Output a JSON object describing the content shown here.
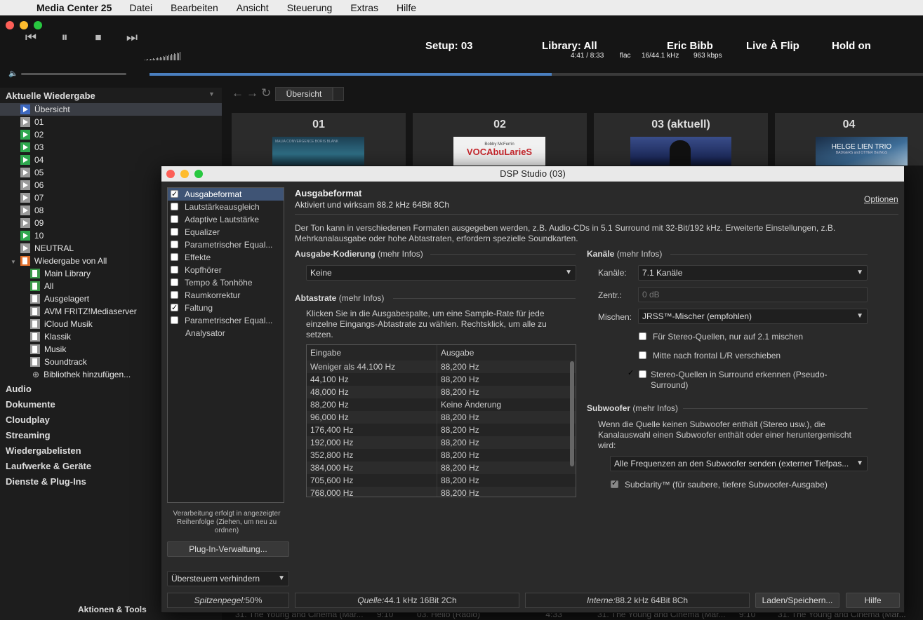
{
  "menubar": {
    "apple": "",
    "app": "Media Center 25",
    "items": [
      "Datei",
      "Bearbeiten",
      "Ansicht",
      "Steuerung",
      "Extras",
      "Hilfe"
    ]
  },
  "transport": {
    "prev": "⏮",
    "pause": "⏸",
    "stop": "⏹",
    "next": "⏭",
    "volume_icon": "🔈"
  },
  "nowplaying": {
    "setup": "Setup: 03",
    "library": "Library: All",
    "time": "4:41 / 8:33",
    "format": "flac",
    "rate": "16/44.1 kHz",
    "bitrate": "963 kbps",
    "artist": "Eric Bibb",
    "album": "Live À Flip",
    "track": "Hold on",
    "progress": 0.52
  },
  "sidebar": {
    "header": "Aktuelle Wiedergabe",
    "items": [
      {
        "label": "Übersicht"
      },
      {
        "label": "01"
      },
      {
        "label": "02"
      },
      {
        "label": "03"
      },
      {
        "label": "04"
      },
      {
        "label": "05"
      },
      {
        "label": "06"
      },
      {
        "label": "07"
      },
      {
        "label": "08"
      },
      {
        "label": "09"
      },
      {
        "label": "10"
      },
      {
        "label": "NEUTRAL"
      },
      {
        "label": "Wiedergabe von All"
      },
      {
        "label": "Main Library"
      },
      {
        "label": "All"
      },
      {
        "label": "Ausgelagert"
      },
      {
        "label": "AVM FRITZ!Mediaserver"
      },
      {
        "label": "iCloud Musik"
      },
      {
        "label": "Klassik"
      },
      {
        "label": "Musik"
      },
      {
        "label": "Soundtrack"
      },
      {
        "label": "Bibliothek hinzufügen..."
      }
    ],
    "sections": [
      "Audio",
      "Dokumente",
      "Cloudplay",
      "Streaming",
      "Wiedergabelisten",
      "Laufwerke & Geräte",
      "Dienste & Plug-Ins"
    ],
    "footer": "Aktionen & Tools"
  },
  "tabs": {
    "overview": "Übersicht"
  },
  "tiles": [
    {
      "title": "01"
    },
    {
      "title": "02"
    },
    {
      "title": "03 (aktuell)"
    },
    {
      "title": "04"
    }
  ],
  "covers": {
    "c1_text": "MALIA   CONVERGENCE   BORIS BLANK",
    "c2_text": "VOCAbuLarieS",
    "c2_sub": "Bobby McFerrin",
    "c4_text": "HELGE LIEN TRIO",
    "c4_sub": "BADGERS and OTHER BEINGS"
  },
  "bgrows": [
    {
      "text": "31. The Young and Cinema (Mar...",
      "dur": "9:10"
    },
    {
      "text": "03. Hello (Radio)",
      "dur": "4:33"
    },
    {
      "text": "31. The Young and Cinema (Mar...",
      "dur": "9:10"
    },
    {
      "text": "31. The Young and Cinema (Mar...",
      "dur": ""
    }
  ],
  "dsp": {
    "title": "DSP Studio (03)",
    "list": [
      {
        "label": "Ausgabeformat",
        "checked": true
      },
      {
        "label": "Lautstärkeausgleich",
        "checked": false
      },
      {
        "label": "Adaptive Lautstärke",
        "checked": false
      },
      {
        "label": "Equalizer",
        "checked": false
      },
      {
        "label": "Parametrischer Equal...",
        "checked": false
      },
      {
        "label": "Effekte",
        "checked": false
      },
      {
        "label": "Kopfhörer",
        "checked": false
      },
      {
        "label": "Tempo & Tonhöhe",
        "checked": false
      },
      {
        "label": "Raumkorrektur",
        "checked": false
      },
      {
        "label": "Faltung",
        "checked": true
      },
      {
        "label": "Parametrischer Equal...",
        "checked": false
      },
      {
        "label": "Analysator",
        "checked": null
      }
    ],
    "order_note": "Verarbeitung erfolgt in angezeigter Reihenfolge (Ziehen, um neu zu ordnen)",
    "plugin_btn": "Plug-In-Verwaltung...",
    "clip_select": "Übersteuern verhindern",
    "heading": "Ausgabeformat",
    "subheading": "Aktiviert und wirksam 88.2 kHz 64Bit 8Ch",
    "options_link": "Optionen",
    "description": "Der Ton kann in verschiedenen Formaten ausgegeben werden, z.B. Audio-CDs in 5.1 Surround mit 32-Bit/192 kHz.  Erweiterte Einstellungen, z.B. Mehrkanalausgabe oder hohe Abtastraten, erfordern spezielle Soundkarten.",
    "encoding_title": "Ausgabe-Kodierung",
    "more": "(mehr Infos)",
    "encoding_value": "Keine",
    "rate_title": "Abtastrate",
    "rate_desc": "Klicken Sie in die Ausgabespalte, um eine Sample-Rate für jede einzelne Eingangs-Abtastrate zu wählen. Rechtsklick, um alle zu setzen.",
    "rate_cols": [
      "Eingabe",
      "Ausgabe"
    ],
    "rates": [
      [
        "Weniger als 44.100 Hz",
        "88,200 Hz"
      ],
      [
        "44,100 Hz",
        "88,200 Hz"
      ],
      [
        "48,000 Hz",
        "88,200 Hz"
      ],
      [
        "88,200 Hz",
        "Keine Änderung"
      ],
      [
        "96,000 Hz",
        "88,200 Hz"
      ],
      [
        "176,400 Hz",
        "88,200 Hz"
      ],
      [
        "192,000 Hz",
        "88,200 Hz"
      ],
      [
        "352,800 Hz",
        "88,200 Hz"
      ],
      [
        "384,000 Hz",
        "88,200 Hz"
      ],
      [
        "705,600 Hz",
        "88,200 Hz"
      ],
      [
        "768,000 Hz",
        "88,200 Hz"
      ]
    ],
    "channels_title": "Kanäle",
    "channels_label": "Kanäle:",
    "channels_value": "7.1 Kanäle",
    "center_label": "Zentr.:",
    "center_value": "0 dB",
    "mix_label": "Mischen:",
    "mix_value": "JRSS™-Mischer (empfohlen)",
    "chk1": "Für Stereo-Quellen, nur auf 2.1 mischen",
    "chk2": "Mitte nach frontal L/R verschieben",
    "chk3": "Stereo-Quellen in Surround erkennen (Pseudo-Surround)",
    "sub_title": "Subwoofer",
    "sub_desc": "Wenn die Quelle keinen Subwoofer enthält (Stereo usw.), die Kanalauswahl einen Subwoofer enthält oder einer heruntergemischt wird:",
    "sub_select": "Alle Frequenzen an den Subwoofer senden (externer Tiefpas...",
    "subclarity": "Subclarity™ (für saubere, tiefere Subwoofer-Ausgabe)",
    "status_peak_label": "Spitzenpegel:",
    "status_peak": "50%",
    "status_src_label": "Quelle:",
    "status_src": "44.1 kHz 16Bit 2Ch",
    "status_int_label": "Interne:",
    "status_int": "88.2 kHz 64Bit 8Ch",
    "load_btn": "Laden/Speichern...",
    "help_btn": "Hilfe"
  }
}
